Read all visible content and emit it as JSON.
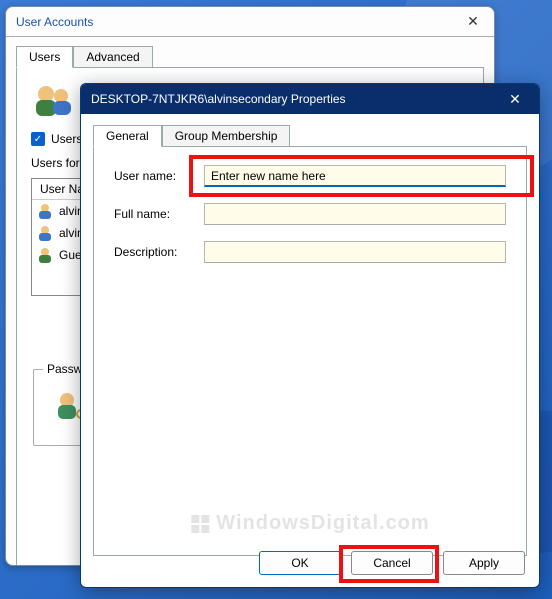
{
  "parent": {
    "title": "User Accounts",
    "tabs": [
      "Users",
      "Advanced"
    ],
    "active_tab": 0,
    "checkbox_label": "Users",
    "users_for_label": "Users for",
    "list_header": "User Na",
    "list_rows": [
      "alvin",
      "alvin",
      "Gue"
    ],
    "password_group_label": "Password"
  },
  "props": {
    "title": "DESKTOP-7NTJKR6\\alvinsecondary Properties",
    "tabs": [
      "General",
      "Group Membership"
    ],
    "active_tab": 0,
    "fields": {
      "username_label": "User name:",
      "username_value": "Enter new name here",
      "fullname_label": "Full name:",
      "fullname_value": "",
      "description_label": "Description:",
      "description_value": ""
    },
    "buttons": {
      "ok": "OK",
      "cancel": "Cancel",
      "apply": "Apply"
    }
  },
  "watermark": "WindowsDigital.com"
}
